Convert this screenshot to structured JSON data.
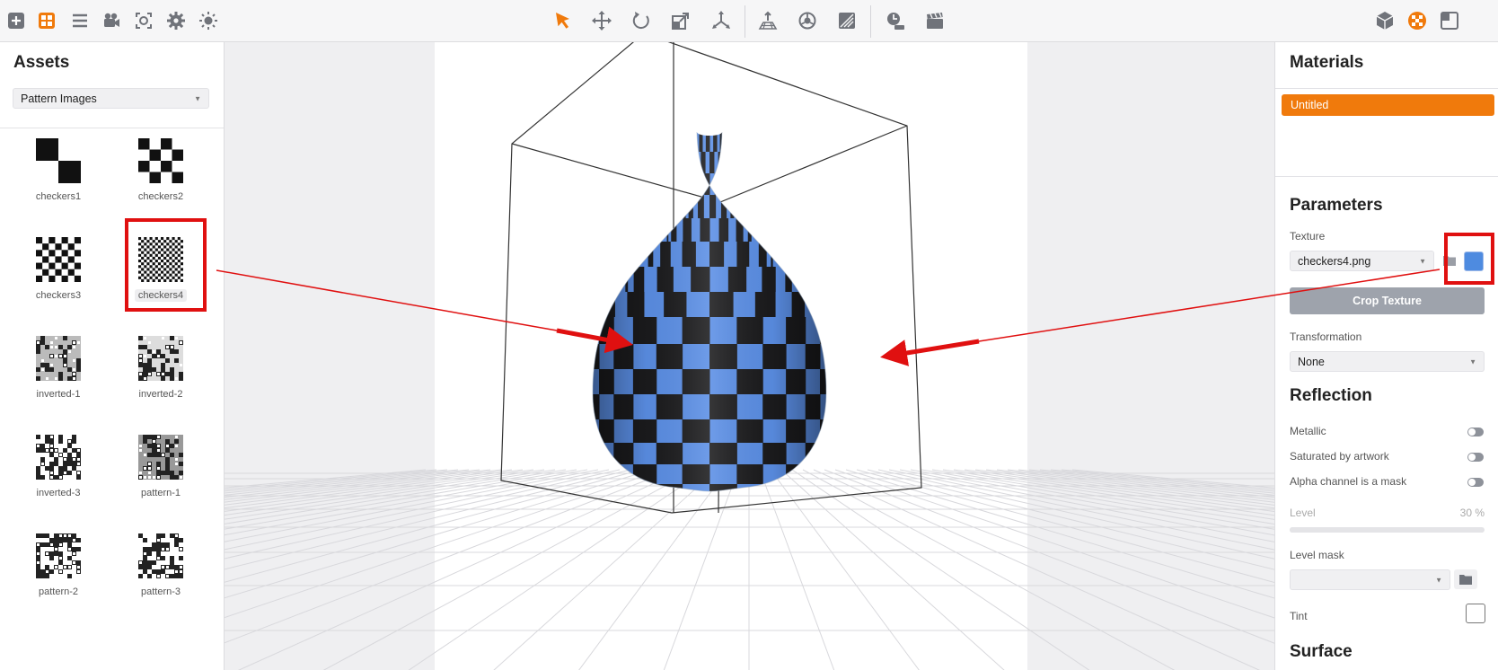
{
  "toolbar": {
    "left_icons": [
      "add-icon",
      "assets-grid-icon",
      "list-icon",
      "camera-icon",
      "capture-icon",
      "settings-gear-icon",
      "light-sun-icon"
    ],
    "center_icons": [
      "select-arrow-icon",
      "move-icon",
      "rotate-icon",
      "scale-icon",
      "pivot-icon",
      "ground-icon",
      "snap-icon",
      "texture-map-icon",
      "timeline-icon",
      "clapper-icon"
    ],
    "right_icons": [
      "model-cube-icon",
      "materials-icon",
      "scene-icon"
    ],
    "accent": "#f07a0c"
  },
  "assets": {
    "title": "Assets",
    "category": "Pattern Images",
    "items": [
      {
        "label": "checkers1",
        "pattern": "checkers1"
      },
      {
        "label": "checkers2",
        "pattern": "checkers2"
      },
      {
        "label": "checkers3",
        "pattern": "checkers3"
      },
      {
        "label": "checkers4",
        "pattern": "checkers4"
      },
      {
        "label": "inverted-1",
        "pattern": "inverted1"
      },
      {
        "label": "inverted-2",
        "pattern": "inverted2"
      },
      {
        "label": "inverted-3",
        "pattern": "inverted3"
      },
      {
        "label": "pattern-1",
        "pattern": "pattern1"
      },
      {
        "label": "pattern-2",
        "pattern": "pattern2"
      },
      {
        "label": "pattern-3",
        "pattern": "pattern3"
      }
    ],
    "selected_index": 3
  },
  "materials": {
    "title": "Materials",
    "list": [
      "Untitled"
    ],
    "parameters_title": "Parameters",
    "texture_label": "Texture",
    "texture_value": "checkers4.png",
    "crop_button": "Crop Texture",
    "transformation_label": "Transformation",
    "transformation_value": "None",
    "reflection_title": "Reflection",
    "metallic_label": "Metallic",
    "saturated_label": "Saturated by artwork",
    "alpha_label": "Alpha channel is a mask",
    "level_label": "Level",
    "level_value": "30 %",
    "level_fraction": 0.3,
    "level_mask_label": "Level mask",
    "tint_label": "Tint",
    "surface_title": "Surface",
    "swatch_color": "#4e8be0"
  },
  "colors": {
    "highlight_red": "#e01010",
    "checker_blue": "#5b8fe6",
    "checker_dark": "#1b1b1d"
  }
}
